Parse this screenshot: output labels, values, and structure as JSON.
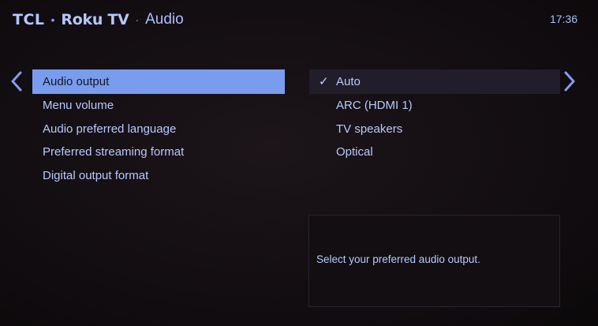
{
  "header": {
    "brand_tcl": "TCL",
    "brand_separator": "•",
    "brand_roku": "Roku TV",
    "title_separator": "·",
    "title": "Audio",
    "clock": "17:36"
  },
  "menu": {
    "items": [
      {
        "label": "Audio output",
        "selected": true
      },
      {
        "label": "Menu volume",
        "selected": false
      },
      {
        "label": "Audio preferred language",
        "selected": false
      },
      {
        "label": "Preferred streaming format",
        "selected": false
      },
      {
        "label": "Digital output format",
        "selected": false
      }
    ]
  },
  "options": {
    "check_mark": "✓",
    "items": [
      {
        "label": "Auto",
        "checked": true
      },
      {
        "label": "ARC (HDMI 1)",
        "checked": false
      },
      {
        "label": "TV speakers",
        "checked": false
      },
      {
        "label": "Optical",
        "checked": false
      }
    ]
  },
  "description": {
    "text": "Select your preferred audio output."
  },
  "icons": {
    "left": "chevron-left-icon",
    "right": "chevron-right-icon",
    "check": "checkmark-icon"
  },
  "colors": {
    "accent": "#7a9cee",
    "text": "#b8c9ff",
    "background": "#130e12"
  }
}
